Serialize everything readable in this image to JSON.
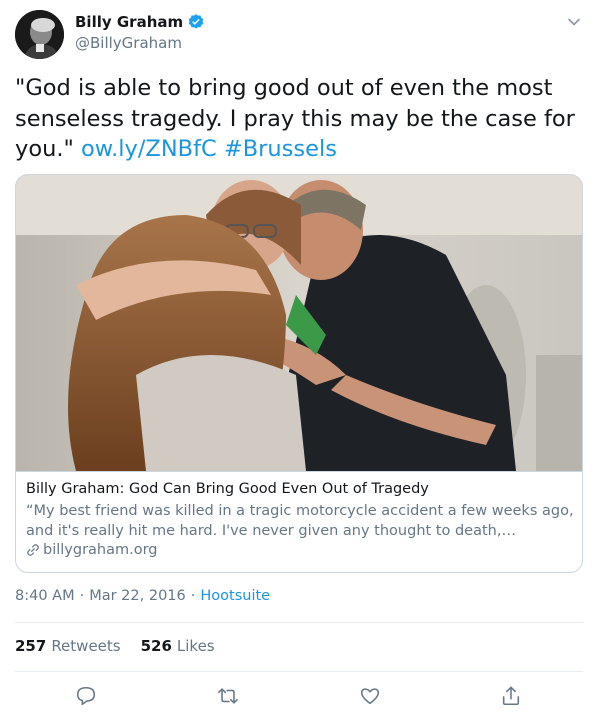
{
  "author": {
    "display_name": "Billy Graham",
    "handle": "@BillyGraham",
    "avatar_icon": "avatar-portrait",
    "verified_icon": "verified-badge-icon"
  },
  "tweet": {
    "text_main": "\"God is able to bring good out of even the most senseless tragedy. I pray this may be the case for you.\"",
    "link_text": "ow.ly/ZNBfC",
    "hashtag_text": "#Brussels"
  },
  "card": {
    "image_alt": "photo-people-embracing",
    "title": "Billy Graham: God Can Bring Good Even Out of Tragedy",
    "description": "“My best friend was killed in a tragic motorcycle accident a few weeks ago, and it's really hit me hard. I've never given any thought to death,…",
    "domain": "billygraham.org"
  },
  "meta": {
    "time": "8:40 AM",
    "separator": "·",
    "date": "Mar 22, 2016",
    "source": "Hootsuite"
  },
  "stats": {
    "retweets_count": "257",
    "retweets_label": "Retweets",
    "likes_count": "526",
    "likes_label": "Likes"
  },
  "colors": {
    "link": "#1b95e0",
    "secondary": "#657786",
    "border": "#ccd6dd",
    "divider": "#e6ecf0"
  }
}
